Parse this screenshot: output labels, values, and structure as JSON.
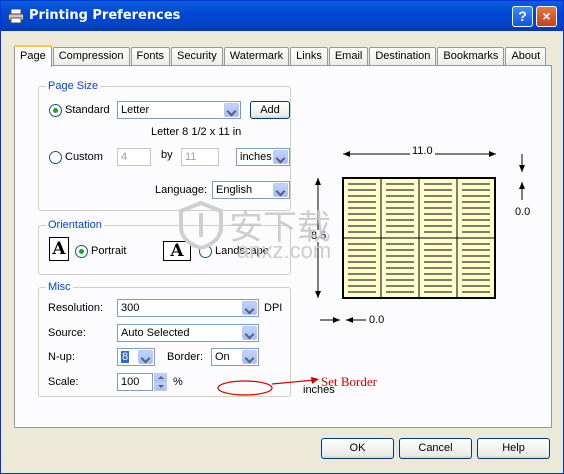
{
  "window": {
    "title": "Printing Preferences",
    "help_label": "?",
    "close_label": "×"
  },
  "tabs": [
    {
      "label": "Page",
      "active": true
    },
    {
      "label": "Compression"
    },
    {
      "label": "Fonts"
    },
    {
      "label": "Security"
    },
    {
      "label": "Watermark"
    },
    {
      "label": "Links"
    },
    {
      "label": "Email"
    },
    {
      "label": "Destination"
    },
    {
      "label": "Bookmarks"
    },
    {
      "label": "About"
    }
  ],
  "page_size": {
    "legend": "Page Size",
    "standard_label": "Standard",
    "standard_selected": true,
    "paper": "Letter",
    "add_label": "Add",
    "paper_description": "Letter 8 1/2 x 11 in",
    "custom_label": "Custom",
    "width": "4",
    "by_label": "by",
    "height": "11",
    "units": "inches",
    "language_label": "Language:",
    "language": "English"
  },
  "orientation": {
    "legend": "Orientation",
    "portrait_icon": "A",
    "portrait_label": "Portrait",
    "portrait_selected": true,
    "landscape_icon": "A",
    "landscape_label": "Landscape"
  },
  "misc": {
    "legend": "Misc",
    "resolution_label": "Resolution:",
    "resolution": "300",
    "dpi_label": "DPI",
    "source_label": "Source:",
    "source": "Auto Selected",
    "nup_label": "N-up:",
    "nup": "8",
    "border_label": "Border:",
    "border": "On",
    "scale_label": "Scale:",
    "scale": "100",
    "percent_label": "%"
  },
  "preview": {
    "width_label": "11.0",
    "height_label": "8.5",
    "right_margin": "0.0",
    "bottom_margin": "0.0",
    "units_label": "inches",
    "nup_columns": 4,
    "nup_rows": 2,
    "paper_color": "#FFFFCC"
  },
  "annotation": {
    "text": "Set Border",
    "color": "#D40000"
  },
  "watermark": {
    "main": "安下载",
    "sub": "anxz.com"
  },
  "buttons": {
    "ok": "OK",
    "cancel": "Cancel",
    "help": "Help"
  }
}
